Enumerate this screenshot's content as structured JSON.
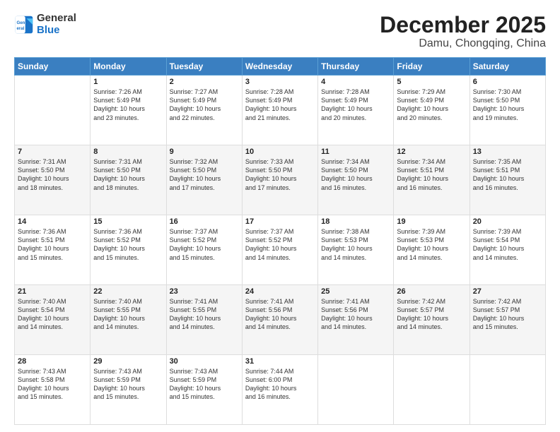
{
  "logo": {
    "line1": "General",
    "line2": "Blue"
  },
  "title": "December 2025",
  "subtitle": "Damu, Chongqing, China",
  "days_header": [
    "Sunday",
    "Monday",
    "Tuesday",
    "Wednesday",
    "Thursday",
    "Friday",
    "Saturday"
  ],
  "weeks": [
    [
      {
        "day": "",
        "info": ""
      },
      {
        "day": "1",
        "info": "Sunrise: 7:26 AM\nSunset: 5:49 PM\nDaylight: 10 hours\nand 23 minutes."
      },
      {
        "day": "2",
        "info": "Sunrise: 7:27 AM\nSunset: 5:49 PM\nDaylight: 10 hours\nand 22 minutes."
      },
      {
        "day": "3",
        "info": "Sunrise: 7:28 AM\nSunset: 5:49 PM\nDaylight: 10 hours\nand 21 minutes."
      },
      {
        "day": "4",
        "info": "Sunrise: 7:28 AM\nSunset: 5:49 PM\nDaylight: 10 hours\nand 20 minutes."
      },
      {
        "day": "5",
        "info": "Sunrise: 7:29 AM\nSunset: 5:49 PM\nDaylight: 10 hours\nand 20 minutes."
      },
      {
        "day": "6",
        "info": "Sunrise: 7:30 AM\nSunset: 5:50 PM\nDaylight: 10 hours\nand 19 minutes."
      }
    ],
    [
      {
        "day": "7",
        "info": "Sunrise: 7:31 AM\nSunset: 5:50 PM\nDaylight: 10 hours\nand 18 minutes."
      },
      {
        "day": "8",
        "info": "Sunrise: 7:31 AM\nSunset: 5:50 PM\nDaylight: 10 hours\nand 18 minutes."
      },
      {
        "day": "9",
        "info": "Sunrise: 7:32 AM\nSunset: 5:50 PM\nDaylight: 10 hours\nand 17 minutes."
      },
      {
        "day": "10",
        "info": "Sunrise: 7:33 AM\nSunset: 5:50 PM\nDaylight: 10 hours\nand 17 minutes."
      },
      {
        "day": "11",
        "info": "Sunrise: 7:34 AM\nSunset: 5:50 PM\nDaylight: 10 hours\nand 16 minutes."
      },
      {
        "day": "12",
        "info": "Sunrise: 7:34 AM\nSunset: 5:51 PM\nDaylight: 10 hours\nand 16 minutes."
      },
      {
        "day": "13",
        "info": "Sunrise: 7:35 AM\nSunset: 5:51 PM\nDaylight: 10 hours\nand 16 minutes."
      }
    ],
    [
      {
        "day": "14",
        "info": "Sunrise: 7:36 AM\nSunset: 5:51 PM\nDaylight: 10 hours\nand 15 minutes."
      },
      {
        "day": "15",
        "info": "Sunrise: 7:36 AM\nSunset: 5:52 PM\nDaylight: 10 hours\nand 15 minutes."
      },
      {
        "day": "16",
        "info": "Sunrise: 7:37 AM\nSunset: 5:52 PM\nDaylight: 10 hours\nand 15 minutes."
      },
      {
        "day": "17",
        "info": "Sunrise: 7:37 AM\nSunset: 5:52 PM\nDaylight: 10 hours\nand 14 minutes."
      },
      {
        "day": "18",
        "info": "Sunrise: 7:38 AM\nSunset: 5:53 PM\nDaylight: 10 hours\nand 14 minutes."
      },
      {
        "day": "19",
        "info": "Sunrise: 7:39 AM\nSunset: 5:53 PM\nDaylight: 10 hours\nand 14 minutes."
      },
      {
        "day": "20",
        "info": "Sunrise: 7:39 AM\nSunset: 5:54 PM\nDaylight: 10 hours\nand 14 minutes."
      }
    ],
    [
      {
        "day": "21",
        "info": "Sunrise: 7:40 AM\nSunset: 5:54 PM\nDaylight: 10 hours\nand 14 minutes."
      },
      {
        "day": "22",
        "info": "Sunrise: 7:40 AM\nSunset: 5:55 PM\nDaylight: 10 hours\nand 14 minutes."
      },
      {
        "day": "23",
        "info": "Sunrise: 7:41 AM\nSunset: 5:55 PM\nDaylight: 10 hours\nand 14 minutes."
      },
      {
        "day": "24",
        "info": "Sunrise: 7:41 AM\nSunset: 5:56 PM\nDaylight: 10 hours\nand 14 minutes."
      },
      {
        "day": "25",
        "info": "Sunrise: 7:41 AM\nSunset: 5:56 PM\nDaylight: 10 hours\nand 14 minutes."
      },
      {
        "day": "26",
        "info": "Sunrise: 7:42 AM\nSunset: 5:57 PM\nDaylight: 10 hours\nand 14 minutes."
      },
      {
        "day": "27",
        "info": "Sunrise: 7:42 AM\nSunset: 5:57 PM\nDaylight: 10 hours\nand 15 minutes."
      }
    ],
    [
      {
        "day": "28",
        "info": "Sunrise: 7:43 AM\nSunset: 5:58 PM\nDaylight: 10 hours\nand 15 minutes."
      },
      {
        "day": "29",
        "info": "Sunrise: 7:43 AM\nSunset: 5:59 PM\nDaylight: 10 hours\nand 15 minutes."
      },
      {
        "day": "30",
        "info": "Sunrise: 7:43 AM\nSunset: 5:59 PM\nDaylight: 10 hours\nand 15 minutes."
      },
      {
        "day": "31",
        "info": "Sunrise: 7:44 AM\nSunset: 6:00 PM\nDaylight: 10 hours\nand 16 minutes."
      },
      {
        "day": "",
        "info": ""
      },
      {
        "day": "",
        "info": ""
      },
      {
        "day": "",
        "info": ""
      }
    ]
  ]
}
